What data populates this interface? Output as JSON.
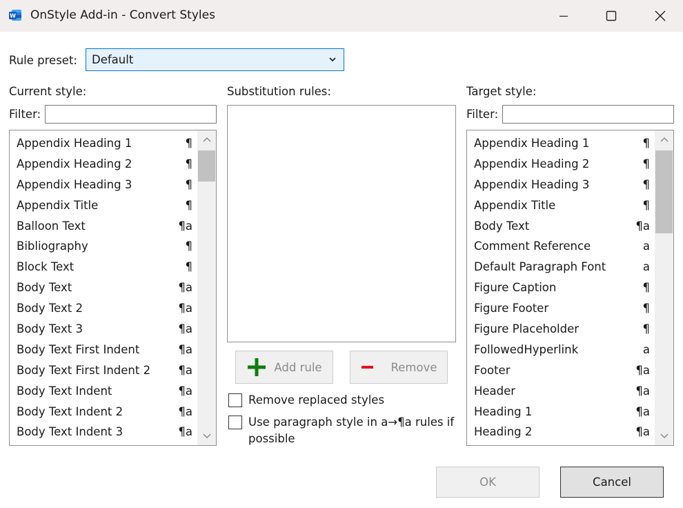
{
  "window": {
    "title": "OnStyle Add-in - Convert Styles",
    "app_icon": "word-icon",
    "controls": [
      "minimize-icon",
      "maximize-icon",
      "close-icon"
    ]
  },
  "preset": {
    "label": "Rule preset:",
    "value": "Default"
  },
  "current": {
    "header": "Current style:",
    "filter_label": "Filter:",
    "filter_value": "",
    "items": [
      {
        "name": "Appendix Heading 1",
        "kind": "¶"
      },
      {
        "name": "Appendix Heading 2",
        "kind": "¶"
      },
      {
        "name": "Appendix Heading 3",
        "kind": "¶"
      },
      {
        "name": "Appendix Title",
        "kind": "¶"
      },
      {
        "name": "Balloon Text",
        "kind": "¶a"
      },
      {
        "name": "Bibliography",
        "kind": "¶"
      },
      {
        "name": "Block Text",
        "kind": "¶"
      },
      {
        "name": "Body Text",
        "kind": "¶a"
      },
      {
        "name": "Body Text 2",
        "kind": "¶a"
      },
      {
        "name": "Body Text 3",
        "kind": "¶a"
      },
      {
        "name": "Body Text First Indent",
        "kind": "¶a"
      },
      {
        "name": "Body Text First Indent 2",
        "kind": "¶a"
      },
      {
        "name": "Body Text Indent",
        "kind": "¶a"
      },
      {
        "name": "Body Text Indent 2",
        "kind": "¶a"
      },
      {
        "name": "Body Text Indent 3",
        "kind": "¶a"
      }
    ]
  },
  "rules": {
    "header": "Substitution rules:",
    "add_label": "Add rule",
    "remove_label": "Remove",
    "opt_remove_replaced": "Remove replaced styles",
    "opt_use_paragraph_line1": "Use paragraph style in a→¶a rules if",
    "opt_use_paragraph_line2": "possible",
    "opt_remove_replaced_checked": false,
    "opt_use_paragraph_checked": false
  },
  "target": {
    "header": "Target style:",
    "filter_label": "Filter:",
    "filter_value": "",
    "items": [
      {
        "name": "Appendix Heading 1",
        "kind": "¶"
      },
      {
        "name": "Appendix Heading 2",
        "kind": "¶"
      },
      {
        "name": "Appendix Heading 3",
        "kind": "¶"
      },
      {
        "name": "Appendix Title",
        "kind": "¶"
      },
      {
        "name": "Body Text",
        "kind": "¶a"
      },
      {
        "name": "Comment Reference",
        "kind": "a"
      },
      {
        "name": "Default Paragraph Font",
        "kind": "a"
      },
      {
        "name": "Figure Caption",
        "kind": "¶"
      },
      {
        "name": "Figure Footer",
        "kind": "¶"
      },
      {
        "name": "Figure Placeholder",
        "kind": "¶"
      },
      {
        "name": "FollowedHyperlink",
        "kind": "a"
      },
      {
        "name": "Footer",
        "kind": "¶a"
      },
      {
        "name": "Header",
        "kind": "¶a"
      },
      {
        "name": "Heading 1",
        "kind": "¶a"
      },
      {
        "name": "Heading 2",
        "kind": "¶a"
      }
    ]
  },
  "footer": {
    "ok_label": "OK",
    "cancel_label": "Cancel"
  },
  "colors": {
    "titlebar": "#f3eeee",
    "select_bg": "#e5f1fb",
    "select_border": "#0078d7",
    "add_icon": "#107c10",
    "remove_icon": "#e81123"
  }
}
